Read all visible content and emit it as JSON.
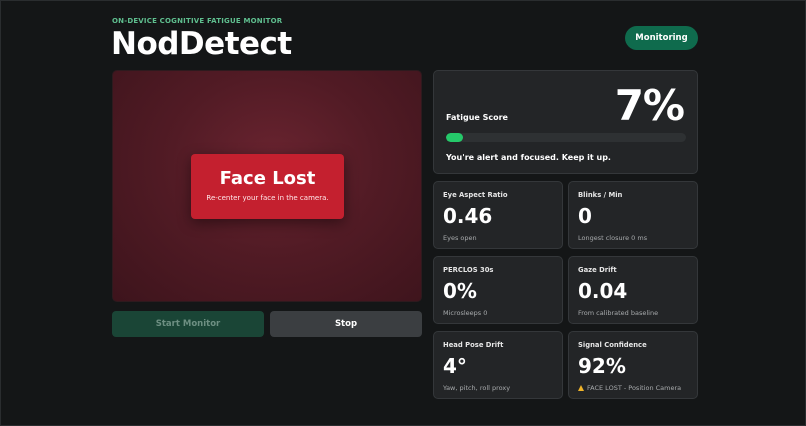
{
  "header": {
    "eyebrow": "ON-DEVICE COGNITIVE FATIGUE MONITOR",
    "title": "NodDetect",
    "status": "Monitoring"
  },
  "camera": {
    "overlay_title": "Face Lost",
    "overlay_message": "Re-center your face in the camera."
  },
  "controls": {
    "start_label": "Start Monitor",
    "stop_label": "Stop"
  },
  "fatigue": {
    "label": "Fatigue Score",
    "value": "7%",
    "level_fraction": 0.07,
    "message": "You're alert and focused. Keep it up."
  },
  "metrics": [
    {
      "label": "Eye Aspect Ratio",
      "value": "0.46",
      "sub": "Eyes open"
    },
    {
      "label": "Blinks / Min",
      "value": "0",
      "sub": "Longest closure 0 ms"
    },
    {
      "label": "PERCLOS 30s",
      "value": "0%",
      "sub": "Microsleeps 0"
    },
    {
      "label": "Gaze Drift",
      "value": "0.04",
      "sub": "From calibrated baseline"
    },
    {
      "label": "Head Pose Drift",
      "value": "4°",
      "sub": "Yaw, pitch, roll proxy"
    },
    {
      "label": "Signal Confidence",
      "value": "92%",
      "sub": "FACE LOST - Position Camera",
      "icon": "warning-icon"
    }
  ],
  "colors": {
    "accent_green": "#25c96a",
    "status_pill": "#0f6b4d",
    "alert_red": "#c4202f",
    "warning": "#f0b429"
  }
}
